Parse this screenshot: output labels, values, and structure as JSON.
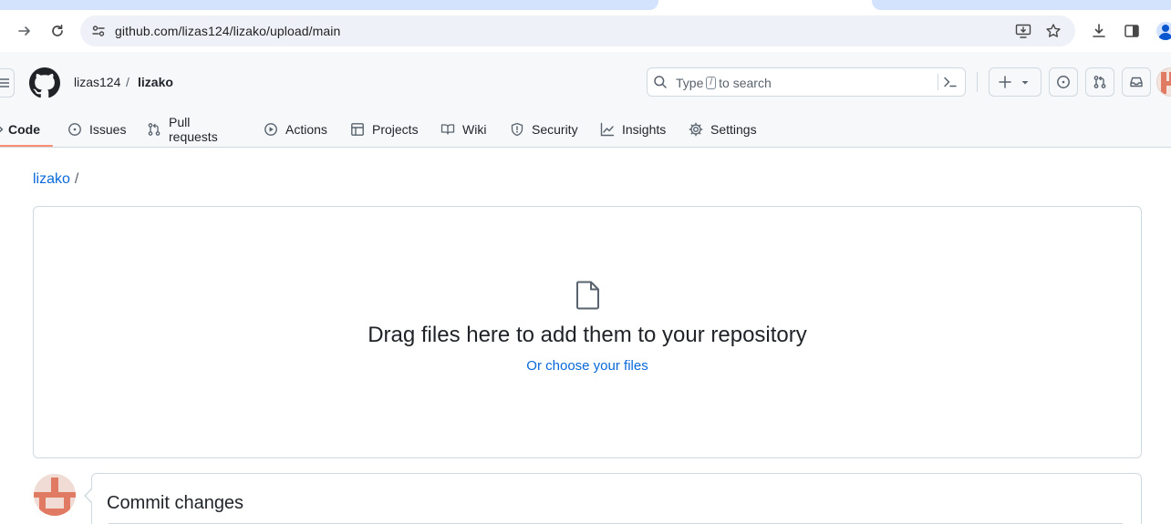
{
  "browser": {
    "url": "github.com/lizas124/lizako/upload/main"
  },
  "header": {
    "owner": "lizas124",
    "separator": "/",
    "repo": "lizako",
    "search": {
      "prefix": "Type",
      "key": "/",
      "suffix": "to search"
    }
  },
  "nav": {
    "items": [
      {
        "label": "Code",
        "icon": "code-icon",
        "selected": true
      },
      {
        "label": "Issues",
        "icon": "issue-opened-icon"
      },
      {
        "label": "Pull requests",
        "icon": "git-pull-request-icon"
      },
      {
        "label": "Actions",
        "icon": "play-icon"
      },
      {
        "label": "Projects",
        "icon": "table-icon"
      },
      {
        "label": "Wiki",
        "icon": "book-icon"
      },
      {
        "label": "Security",
        "icon": "shield-icon"
      },
      {
        "label": "Insights",
        "icon": "graph-icon"
      },
      {
        "label": "Settings",
        "icon": "gear-icon"
      }
    ]
  },
  "main": {
    "breadcrumb": {
      "repo": "lizako",
      "sep": "/"
    },
    "dropzone": {
      "title": "Drag files here to add them to your repository",
      "or_text": "Or",
      "choose_text": "choose your files"
    },
    "commit": {
      "title": "Commit changes"
    }
  },
  "colors": {
    "accent_link": "#0969da",
    "nav_underline": "#fd8c73",
    "border": "#d1d9e0",
    "avatar": "#e07a62"
  }
}
